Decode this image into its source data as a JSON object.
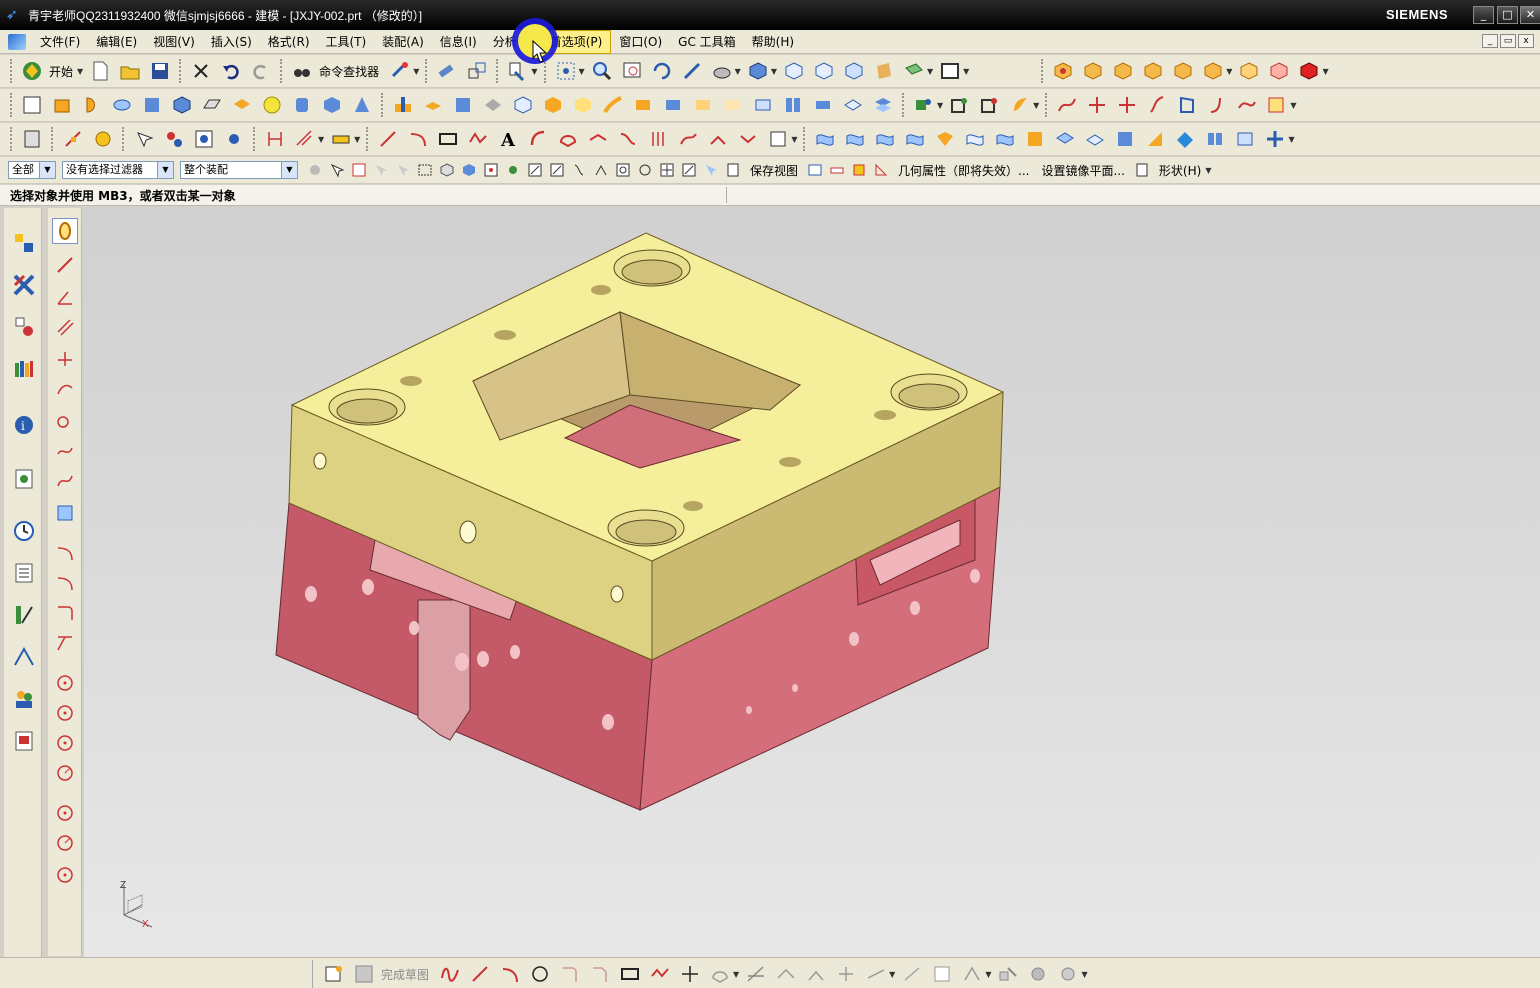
{
  "titlebar": {
    "title": "青宇老师QQ2311932400 微信sjmjsj6666 - 建模 - [JXJY-002.prt （修改的）]",
    "brand": "SIEMENS",
    "min": "_",
    "max": "□",
    "close": "✕"
  },
  "menu": {
    "items": [
      "文件(F)",
      "编辑(E)",
      "视图(V)",
      "插入(S)",
      "格式(R)",
      "工具(T)",
      "装配(A)",
      "信息(I)",
      "分析(L)",
      "首选项(P)",
      "窗口(O)",
      "GC 工具箱",
      "帮助(H)"
    ],
    "hovered_index": 9
  },
  "toolbar1": {
    "start_label": "开始",
    "command_finder_label": "命令查找器"
  },
  "selection": {
    "filter_type": "全部",
    "selection_filter": "没有选择过滤器",
    "scope": "整个装配",
    "save_view_label": "保存视图",
    "geom_props_label": "几何属性（即将失效）...",
    "mirror_plane_label": "设置镜像平面...",
    "shape_label": "形状(H)"
  },
  "cue": {
    "text": "选择对象并使用 MB3，或者双击某一对象"
  },
  "bottom": {
    "finish_sketch_label": "完成草图"
  },
  "triad": {
    "z": "Z",
    "x": "X"
  },
  "colors": {
    "plate_top": "#f5ef9c",
    "plate_side_left": "#ddd182",
    "plate_side_right": "#c9b872",
    "block_left": "#c5606e",
    "block_right": "#d0707c",
    "accent": "#1a1ad8"
  }
}
